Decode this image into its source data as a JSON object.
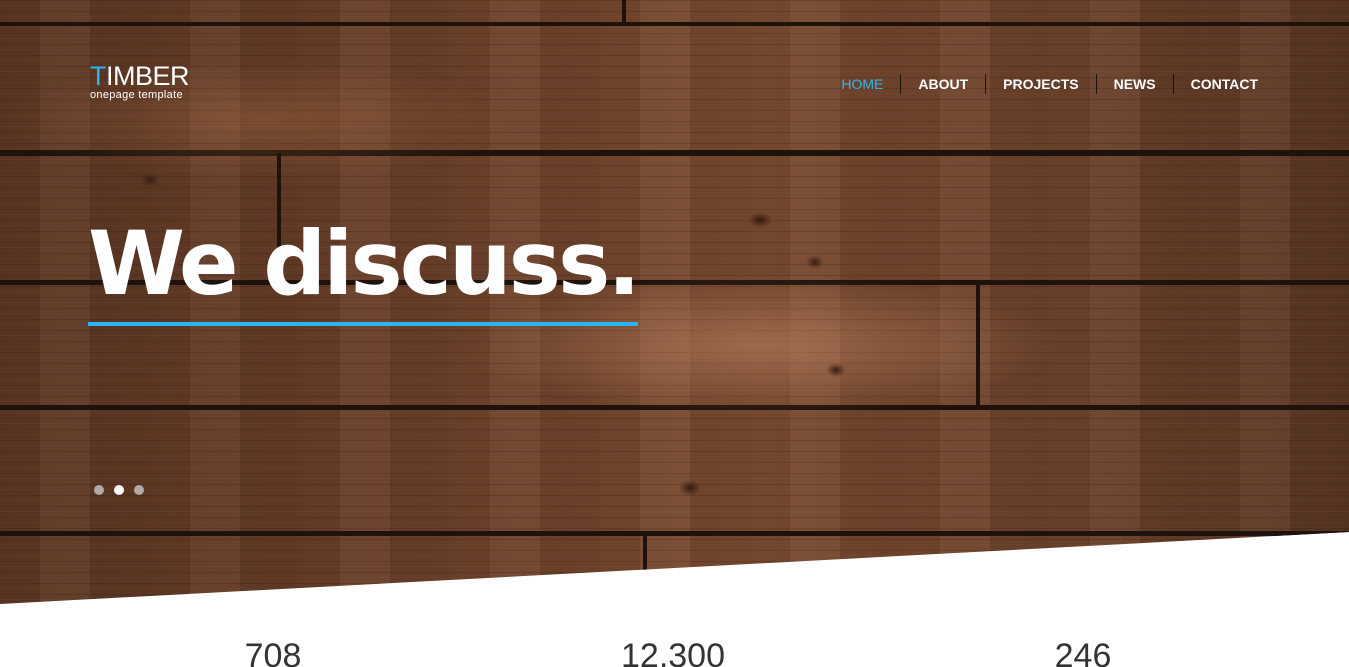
{
  "brand": {
    "accent_letter": "T",
    "name_rest": "IMBER",
    "tagline": "onepage template",
    "accent_color": "#29b6ef"
  },
  "nav": {
    "items": [
      {
        "label": "HOME",
        "active": true
      },
      {
        "label": "ABOUT",
        "active": false
      },
      {
        "label": "PROJECTS",
        "active": false
      },
      {
        "label": "NEWS",
        "active": false
      },
      {
        "label": "CONTACT",
        "active": false
      }
    ]
  },
  "hero": {
    "headline": "We discuss.",
    "slider": {
      "slide_count": 3,
      "active_index": 1
    }
  },
  "stats": [
    {
      "value": "708"
    },
    {
      "value": "12,300"
    },
    {
      "value": "246"
    }
  ]
}
